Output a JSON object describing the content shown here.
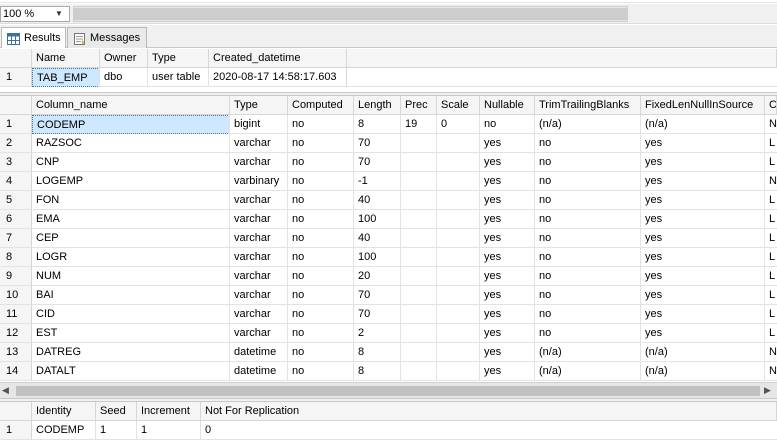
{
  "toolbar": {
    "zoom_value": "100 %"
  },
  "tabs": [
    {
      "label": "Results",
      "icon": "grid-icon"
    },
    {
      "label": "Messages",
      "icon": "messages-icon"
    }
  ],
  "grid1": {
    "columns": [
      "Name",
      "Owner",
      "Type",
      "Created_datetime"
    ],
    "rows": [
      {
        "num": "1",
        "cells": [
          "TAB_EMP",
          "dbo",
          "user table",
          "2020-08-17 14:58:17.603"
        ]
      }
    ]
  },
  "grid2": {
    "columns": [
      "Column_name",
      "Type",
      "Computed",
      "Length",
      "Prec",
      "Scale",
      "Nullable",
      "TrimTrailingBlanks",
      "FixedLenNullInSource",
      "C"
    ],
    "rows": [
      {
        "num": "1",
        "cells": [
          "CODEMP",
          "bigint",
          "no",
          "8",
          "19",
          "0",
          "no",
          "(n/a)",
          "(n/a)",
          "N"
        ]
      },
      {
        "num": "2",
        "cells": [
          "RAZSOC",
          "varchar",
          "no",
          "70",
          "",
          "",
          "yes",
          "no",
          "yes",
          "L"
        ]
      },
      {
        "num": "3",
        "cells": [
          "CNP",
          "varchar",
          "no",
          "70",
          "",
          "",
          "yes",
          "no",
          "yes",
          "L"
        ]
      },
      {
        "num": "4",
        "cells": [
          "LOGEMP",
          "varbinary",
          "no",
          "-1",
          "",
          "",
          "yes",
          "no",
          "yes",
          "N"
        ]
      },
      {
        "num": "5",
        "cells": [
          "FON",
          "varchar",
          "no",
          "40",
          "",
          "",
          "yes",
          "no",
          "yes",
          "L"
        ]
      },
      {
        "num": "6",
        "cells": [
          "EMA",
          "varchar",
          "no",
          "100",
          "",
          "",
          "yes",
          "no",
          "yes",
          "L"
        ]
      },
      {
        "num": "7",
        "cells": [
          "CEP",
          "varchar",
          "no",
          "40",
          "",
          "",
          "yes",
          "no",
          "yes",
          "L"
        ]
      },
      {
        "num": "8",
        "cells": [
          "LOGR",
          "varchar",
          "no",
          "100",
          "",
          "",
          "yes",
          "no",
          "yes",
          "L"
        ]
      },
      {
        "num": "9",
        "cells": [
          "NUM",
          "varchar",
          "no",
          "20",
          "",
          "",
          "yes",
          "no",
          "yes",
          "L"
        ]
      },
      {
        "num": "10",
        "cells": [
          "BAI",
          "varchar",
          "no",
          "70",
          "",
          "",
          "yes",
          "no",
          "yes",
          "L"
        ]
      },
      {
        "num": "11",
        "cells": [
          "CID",
          "varchar",
          "no",
          "70",
          "",
          "",
          "yes",
          "no",
          "yes",
          "L"
        ]
      },
      {
        "num": "12",
        "cells": [
          "EST",
          "varchar",
          "no",
          "2",
          "",
          "",
          "yes",
          "no",
          "yes",
          "L"
        ]
      },
      {
        "num": "13",
        "cells": [
          "DATREG",
          "datetime",
          "no",
          "8",
          "",
          "",
          "yes",
          "(n/a)",
          "(n/a)",
          "N"
        ]
      },
      {
        "num": "14",
        "cells": [
          "DATALT",
          "datetime",
          "no",
          "8",
          "",
          "",
          "yes",
          "(n/a)",
          "(n/a)",
          "N"
        ]
      }
    ]
  },
  "grid3": {
    "columns": [
      "Identity",
      "Seed",
      "Increment",
      "Not For Replication"
    ],
    "rows": [
      {
        "num": "1",
        "cells": [
          "CODEMP",
          "1",
          "1",
          "0"
        ]
      }
    ]
  }
}
